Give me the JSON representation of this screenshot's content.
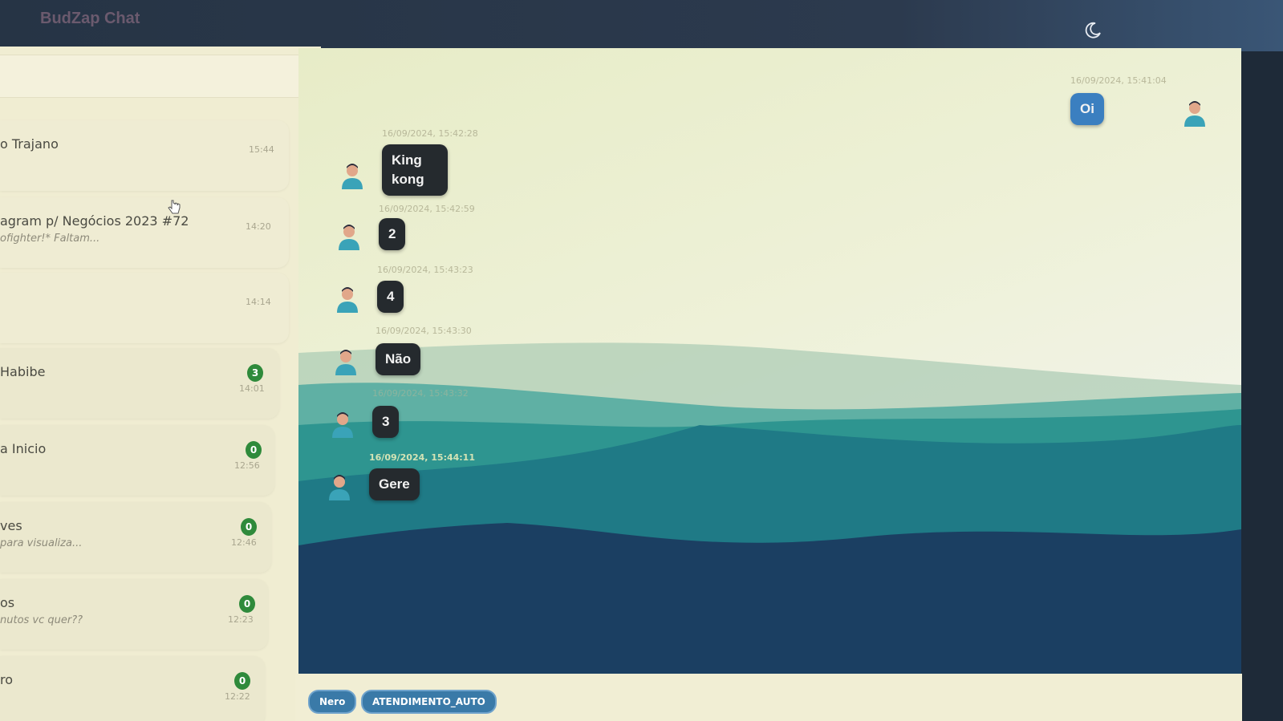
{
  "app": {
    "title": "BudZap Chat",
    "theme_toggle_icon": "moon-icon"
  },
  "sidebar": {
    "search_placeholder": "",
    "chats": [
      {
        "name": "o Trajano",
        "preview": "",
        "time": "15:44",
        "unread": ""
      },
      {
        "name": "agram p/ Negócios 2023 #72",
        "preview": "ofighter!* Faltam...",
        "time": "14:20",
        "unread": ""
      },
      {
        "name": "",
        "preview": "",
        "time": "14:14",
        "unread": ""
      },
      {
        "name": "Habibe",
        "preview": "",
        "time": "14:01",
        "unread": "3"
      },
      {
        "name": "a Inicio",
        "preview": "",
        "time": "12:56",
        "unread": "0"
      },
      {
        "name": "ves",
        "preview": "para visualiza...",
        "time": "12:46",
        "unread": "0"
      },
      {
        "name": "os",
        "preview": "nutos vc quer??",
        "time": "12:23",
        "unread": "0"
      },
      {
        "name": "ro",
        "preview": "",
        "time": "12:22",
        "unread": "0"
      }
    ]
  },
  "conversation": {
    "messages": [
      {
        "direction": "out",
        "timestamp": "16/09/2024, 15:41:04",
        "text": "Oi"
      },
      {
        "direction": "in",
        "timestamp": "16/09/2024, 15:42:28",
        "text": "King kong"
      },
      {
        "direction": "in",
        "timestamp": "16/09/2024, 15:42:59",
        "text": "2"
      },
      {
        "direction": "in",
        "timestamp": "16/09/2024, 15:43:23",
        "text": "4"
      },
      {
        "direction": "in",
        "timestamp": "16/09/2024, 15:43:30",
        "text": "Não"
      },
      {
        "direction": "in",
        "timestamp": "16/09/2024, 15:43:32",
        "text": "3"
      },
      {
        "direction": "in",
        "timestamp": "16/09/2024, 15:44:11",
        "text": "Gere"
      }
    ]
  },
  "footer": {
    "tags": [
      "Nero",
      "ATENDIMENTO_AUTO"
    ]
  },
  "colors": {
    "accent": "#3b7fc0",
    "bubble_in": "#252a2e",
    "badge": "#2f8a3b",
    "sidebar_bg": "#f0edd2"
  }
}
